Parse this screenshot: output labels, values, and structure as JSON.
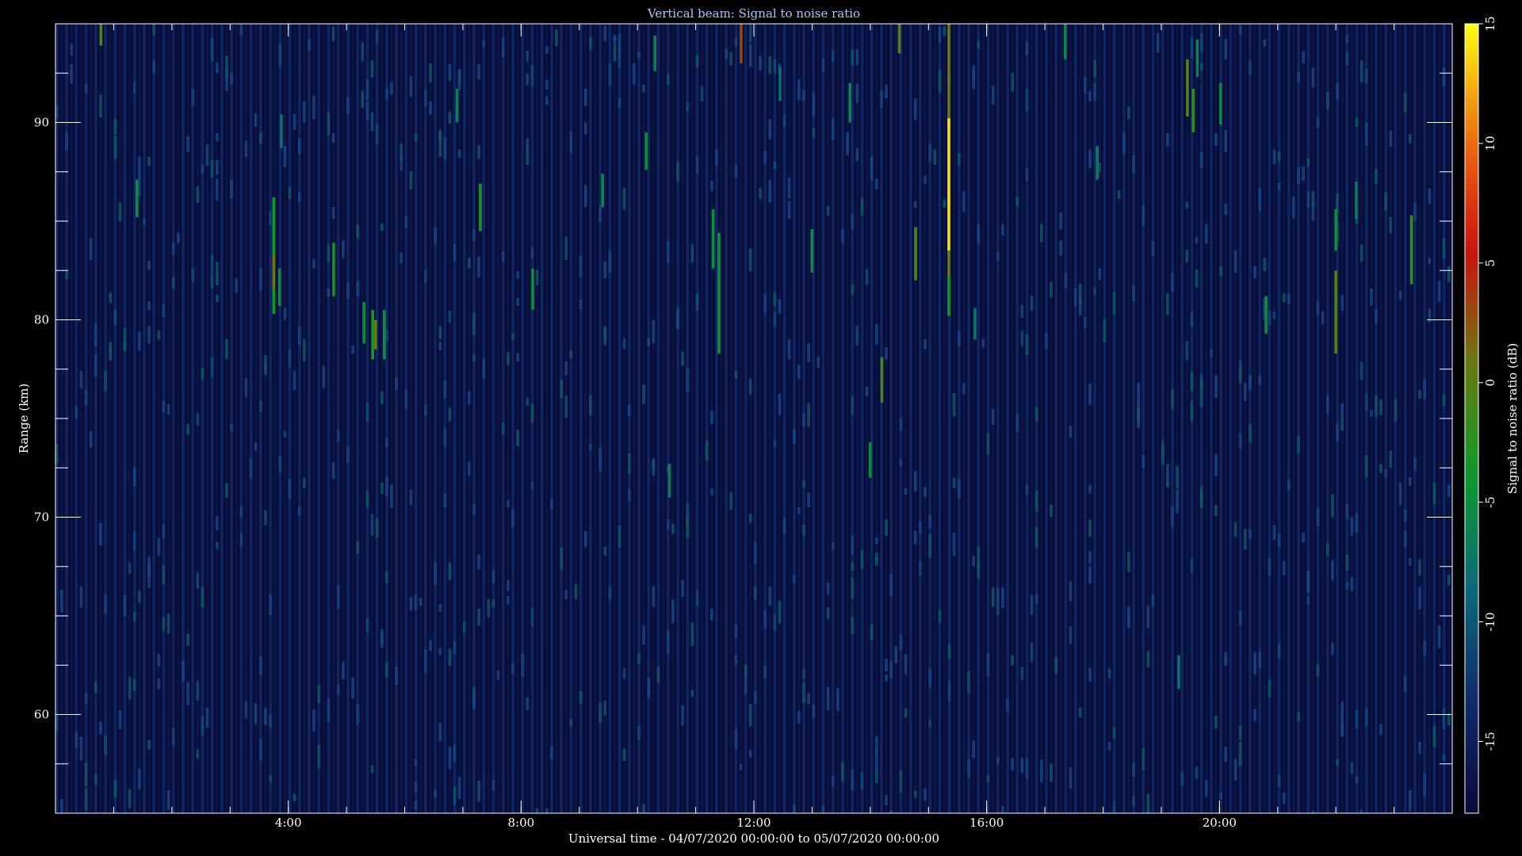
{
  "chart_data": {
    "type": "heatmap",
    "title": "Vertical beam: Signal to noise ratio",
    "xlabel": "Universal time - 04/07/2020 00:00:00 to 05/07/2020 00:00:00",
    "ylabel": "Range (km)",
    "colorbar_label": "Signal to noise ratio (dB)",
    "x_unit": "hours UT",
    "xlim": [
      0,
      24
    ],
    "ylim": [
      55,
      95
    ],
    "x_ticks": [
      {
        "value": 4,
        "label": "4:00"
      },
      {
        "value": 8,
        "label": "8:00"
      },
      {
        "value": 12,
        "label": "12:00"
      },
      {
        "value": 16,
        "label": "16:00"
      },
      {
        "value": 20,
        "label": "20:00"
      }
    ],
    "y_ticks": [
      {
        "value": 60,
        "label": "60"
      },
      {
        "value": 70,
        "label": "70"
      },
      {
        "value": 80,
        "label": "80"
      },
      {
        "value": 90,
        "label": "90"
      }
    ],
    "colorbar_range": [
      -18,
      15
    ],
    "colorbar_ticks": [
      {
        "value": -15,
        "label": "-15"
      },
      {
        "value": -10,
        "label": "-10"
      },
      {
        "value": -5,
        "label": "-5"
      },
      {
        "value": 0,
        "label": "0"
      },
      {
        "value": 5,
        "label": "5"
      },
      {
        "value": 10,
        "label": "10"
      },
      {
        "value": 15,
        "label": "15"
      }
    ],
    "background_snr_db": -16,
    "colormap": [
      "#0a0a3a",
      "#0f2a6a",
      "#0c6a7a",
      "#0c9a2a",
      "#6a7a10",
      "#cc1010",
      "#ee7010",
      "#ffff10"
    ],
    "frame_color": "#ffffff",
    "echoes": [
      {
        "t": 0.78,
        "r0": 93.9,
        "r1": 95.0,
        "snr": -1
      },
      {
        "t": 1.4,
        "r0": 85.2,
        "r1": 87.1,
        "snr": -5
      },
      {
        "t": 3.75,
        "r0": 80.3,
        "r1": 86.2,
        "snr": -4
      },
      {
        "t": 3.75,
        "r0": 81.5,
        "r1": 83.3,
        "snr": 1
      },
      {
        "t": 3.85,
        "r0": 80.7,
        "r1": 82.6,
        "snr": -5
      },
      {
        "t": 3.88,
        "r0": 88.7,
        "r1": 90.4,
        "snr": -8
      },
      {
        "t": 4.78,
        "r0": 81.2,
        "r1": 83.9,
        "snr": -4
      },
      {
        "t": 5.3,
        "r0": 78.8,
        "r1": 80.9,
        "snr": -5
      },
      {
        "t": 5.45,
        "r0": 78.0,
        "r1": 80.5,
        "snr": -3
      },
      {
        "t": 5.5,
        "r0": 78.5,
        "r1": 80.0,
        "snr": 0
      },
      {
        "t": 5.65,
        "r0": 78.0,
        "r1": 80.5,
        "snr": -5
      },
      {
        "t": 6.9,
        "r0": 90.0,
        "r1": 91.7,
        "snr": -6
      },
      {
        "t": 7.3,
        "r0": 84.5,
        "r1": 86.9,
        "snr": -3
      },
      {
        "t": 8.2,
        "r0": 80.5,
        "r1": 82.6,
        "snr": -5
      },
      {
        "t": 9.4,
        "r0": 85.7,
        "r1": 87.4,
        "snr": -6
      },
      {
        "t": 10.15,
        "r0": 87.6,
        "r1": 89.5,
        "snr": -5
      },
      {
        "t": 10.3,
        "r0": 92.6,
        "r1": 94.4,
        "snr": -6
      },
      {
        "t": 10.55,
        "r0": 71.0,
        "r1": 72.7,
        "snr": -7
      },
      {
        "t": 11.3,
        "r0": 82.6,
        "r1": 85.6,
        "snr": -5
      },
      {
        "t": 11.4,
        "r0": 78.3,
        "r1": 84.4,
        "snr": -5
      },
      {
        "t": 11.78,
        "r0": 93.0,
        "r1": 95.0,
        "snr": 3
      },
      {
        "t": 12.45,
        "r0": 91.1,
        "r1": 92.8,
        "snr": -8
      },
      {
        "t": 13.0,
        "r0": 82.4,
        "r1": 84.6,
        "snr": -5
      },
      {
        "t": 13.65,
        "r0": 90.0,
        "r1": 92.0,
        "snr": -6
      },
      {
        "t": 14.0,
        "r0": 72.0,
        "r1": 73.8,
        "snr": -5
      },
      {
        "t": 14.2,
        "r0": 75.8,
        "r1": 78.1,
        "snr": -1
      },
      {
        "t": 14.5,
        "r0": 93.5,
        "r1": 95.0,
        "snr": 0
      },
      {
        "t": 14.78,
        "r0": 82.0,
        "r1": 84.7,
        "snr": -1
      },
      {
        "t": 15.35,
        "r0": 90.0,
        "r1": 95.0,
        "snr": 1
      },
      {
        "t": 15.35,
        "r0": 83.5,
        "r1": 90.2,
        "snr": 14
      },
      {
        "t": 15.35,
        "r0": 82.2,
        "r1": 83.5,
        "snr": 1
      },
      {
        "t": 15.35,
        "r0": 80.2,
        "r1": 82.2,
        "snr": -4
      },
      {
        "t": 15.8,
        "r0": 79.0,
        "r1": 80.6,
        "snr": -7
      },
      {
        "t": 17.35,
        "r0": 93.2,
        "r1": 95.0,
        "snr": -6
      },
      {
        "t": 17.9,
        "r0": 87.1,
        "r1": 88.8,
        "snr": -7
      },
      {
        "t": 19.3,
        "r0": 61.3,
        "r1": 63.0,
        "snr": -8
      },
      {
        "t": 19.45,
        "r0": 90.3,
        "r1": 93.2,
        "snr": 0
      },
      {
        "t": 19.55,
        "r0": 89.5,
        "r1": 91.7,
        "snr": -2
      },
      {
        "t": 19.62,
        "r0": 92.3,
        "r1": 94.2,
        "snr": -6
      },
      {
        "t": 20.02,
        "r0": 89.9,
        "r1": 92.0,
        "snr": -6
      },
      {
        "t": 20.8,
        "r0": 79.3,
        "r1": 81.2,
        "snr": -5
      },
      {
        "t": 22.0,
        "r0": 78.3,
        "r1": 82.5,
        "snr": 0
      },
      {
        "t": 22.0,
        "r0": 83.5,
        "r1": 85.6,
        "snr": -5
      },
      {
        "t": 22.35,
        "r0": 85.1,
        "r1": 87.0,
        "snr": -7
      },
      {
        "t": 23.3,
        "r0": 81.8,
        "r1": 85.3,
        "snr": -2
      }
    ]
  }
}
